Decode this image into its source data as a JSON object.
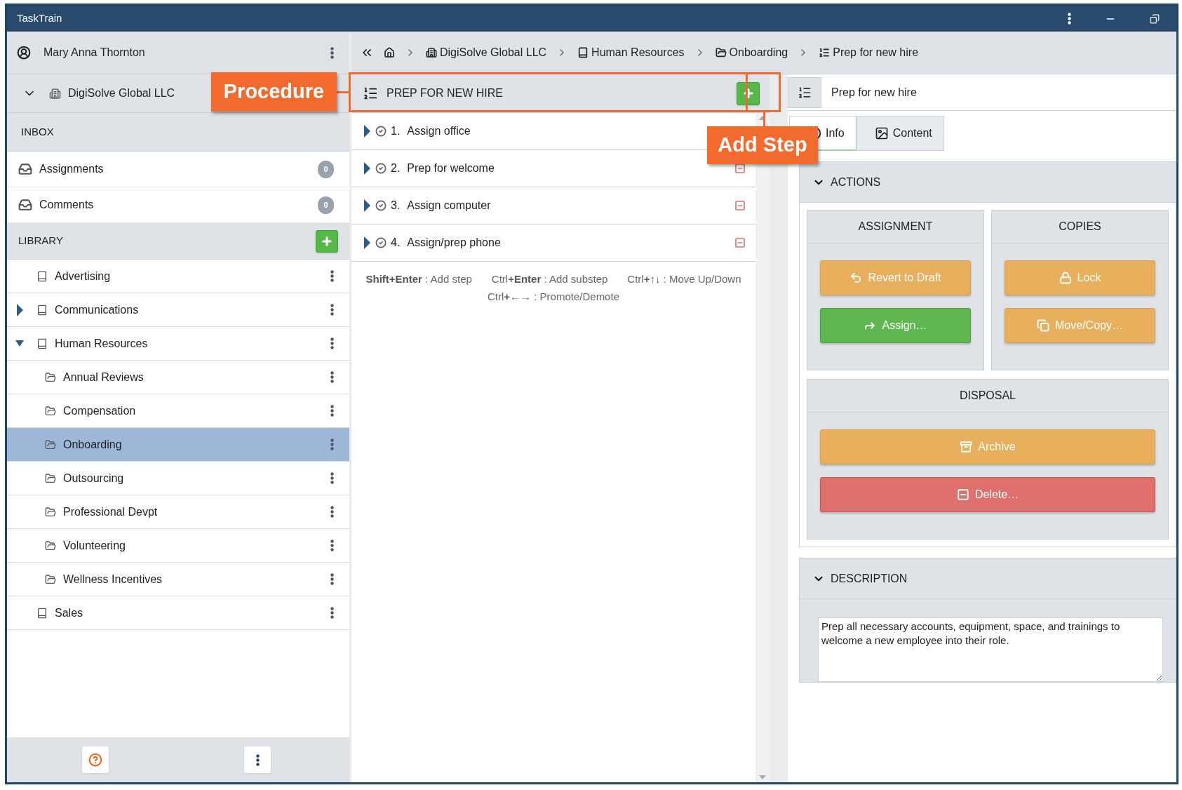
{
  "window": {
    "title": "TaskTrain"
  },
  "user": {
    "name": "Mary Anna Thornton"
  },
  "organization": {
    "name": "DigiSolve Global LLC",
    "expanded": true
  },
  "inbox": {
    "label": "INBOX",
    "items": [
      {
        "name": "Assignments",
        "count": "0"
      },
      {
        "name": "Comments",
        "count": "0"
      }
    ]
  },
  "library": {
    "label": "LIBRARY",
    "items": [
      {
        "name": "Advertising",
        "selected": false
      },
      {
        "name": "Communications",
        "expanded": false,
        "selected": false
      },
      {
        "name": "Human Resources",
        "expanded": true,
        "selected": false,
        "children": [
          {
            "name": "Annual Reviews",
            "selected": false
          },
          {
            "name": "Compensation",
            "selected": false
          },
          {
            "name": "Onboarding",
            "selected": true
          },
          {
            "name": "Outsourcing",
            "selected": false
          },
          {
            "name": "Professional Devpt",
            "selected": false
          },
          {
            "name": "Volunteering",
            "selected": false
          },
          {
            "name": "Wellness Incentives",
            "selected": false
          }
        ]
      },
      {
        "name": "Sales",
        "selected": false
      }
    ]
  },
  "breadcrumb": [
    {
      "kind": "home"
    },
    {
      "kind": "organization",
      "label": "DigiSolve Global LLC"
    },
    {
      "kind": "book",
      "label": "Human Resources"
    },
    {
      "kind": "folder",
      "label": "Onboarding"
    },
    {
      "kind": "procedure",
      "label": "Prep for new hire"
    }
  ],
  "procedure": {
    "title": "PREP FOR NEW HIRE",
    "steps": [
      {
        "number": "1.",
        "title": "Assign office",
        "expanded": false,
        "removable": false
      },
      {
        "number": "2.",
        "title": "Prep for welcome",
        "expanded": false,
        "removable": true
      },
      {
        "number": "3.",
        "title": "Assign computer",
        "expanded": false,
        "removable": true
      },
      {
        "number": "4.",
        "title": "Assign/prep phone",
        "expanded": false,
        "removable": true
      }
    ],
    "shortcuts": [
      "**Shift+Enter** : Add step",
      "Ctrl**+Enter** : Add substep",
      "Ctrl**+**↑↓ : Move Up/Down",
      "Ctrl**+**←→ : Promote/Demote"
    ]
  },
  "details": {
    "title": "Prep for new hire",
    "tabs": [
      {
        "kind": "info",
        "label": "Info",
        "selected": true
      },
      {
        "kind": "content",
        "label": "Content",
        "selected": false
      }
    ],
    "actions": {
      "label": "ACTIONS",
      "expanded": true,
      "groups": [
        {
          "title": "ASSIGNMENT",
          "buttons": [
            {
              "kind": "revert",
              "label": "Revert to Draft"
            },
            {
              "kind": "assign",
              "label": "Assign…"
            }
          ]
        },
        {
          "title": "COPIES",
          "buttons": [
            {
              "kind": "lock",
              "label": "Lock"
            },
            {
              "kind": "move",
              "label": "Move/Copy…"
            }
          ]
        },
        {
          "title": "DISPOSAL",
          "buttons": [
            {
              "kind": "archive",
              "label": "Archive"
            },
            {
              "kind": "delete",
              "label": "Delete…"
            }
          ]
        }
      ]
    },
    "description": {
      "label": "DESCRIPTION",
      "expanded": true,
      "text": "Prep all necessary accounts, equipment, space, and trainings to welcome a new employee into their role."
    }
  },
  "annotations": [
    {
      "label": "Procedure"
    },
    {
      "label": "Add Step"
    }
  ]
}
